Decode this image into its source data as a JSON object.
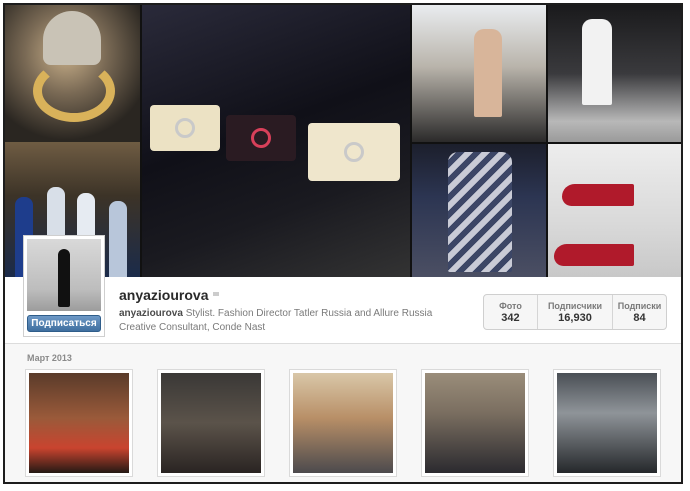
{
  "profile": {
    "username": "anyaziourova",
    "bio_name": "anyaziourova",
    "bio_text": " Stylist. Fashion Director Tatler Russia and Allure Russia Creative Consultant, Conde Nast",
    "follow_label": "Подписаться",
    "stats": [
      {
        "label": "Фото",
        "value": "342"
      },
      {
        "label": "Подписчики",
        "value": "16,930"
      },
      {
        "label": "Подписки",
        "value": "84"
      }
    ]
  },
  "hero_tiles": [
    {
      "icon": "necklace-photo"
    },
    {
      "icon": "boutique-photo"
    },
    {
      "icon": "chanel-clutches-photo"
    },
    {
      "icon": "runway-coat-photo"
    },
    {
      "icon": "runway-white-dress-photo"
    },
    {
      "icon": "embellished-dress-photo"
    },
    {
      "icon": "red-heels-photo"
    }
  ],
  "feed": {
    "month_label": "Март 2013",
    "photos": [
      {
        "icon": "dress-exhibit-photo"
      },
      {
        "icon": "bags-photo"
      },
      {
        "icon": "selfie-photo"
      },
      {
        "icon": "magazine-photo"
      },
      {
        "icon": "crystal-balls-photo"
      }
    ]
  },
  "colors": {
    "follow_button": "#3f6f9f",
    "frame": "#1d1d1d"
  }
}
